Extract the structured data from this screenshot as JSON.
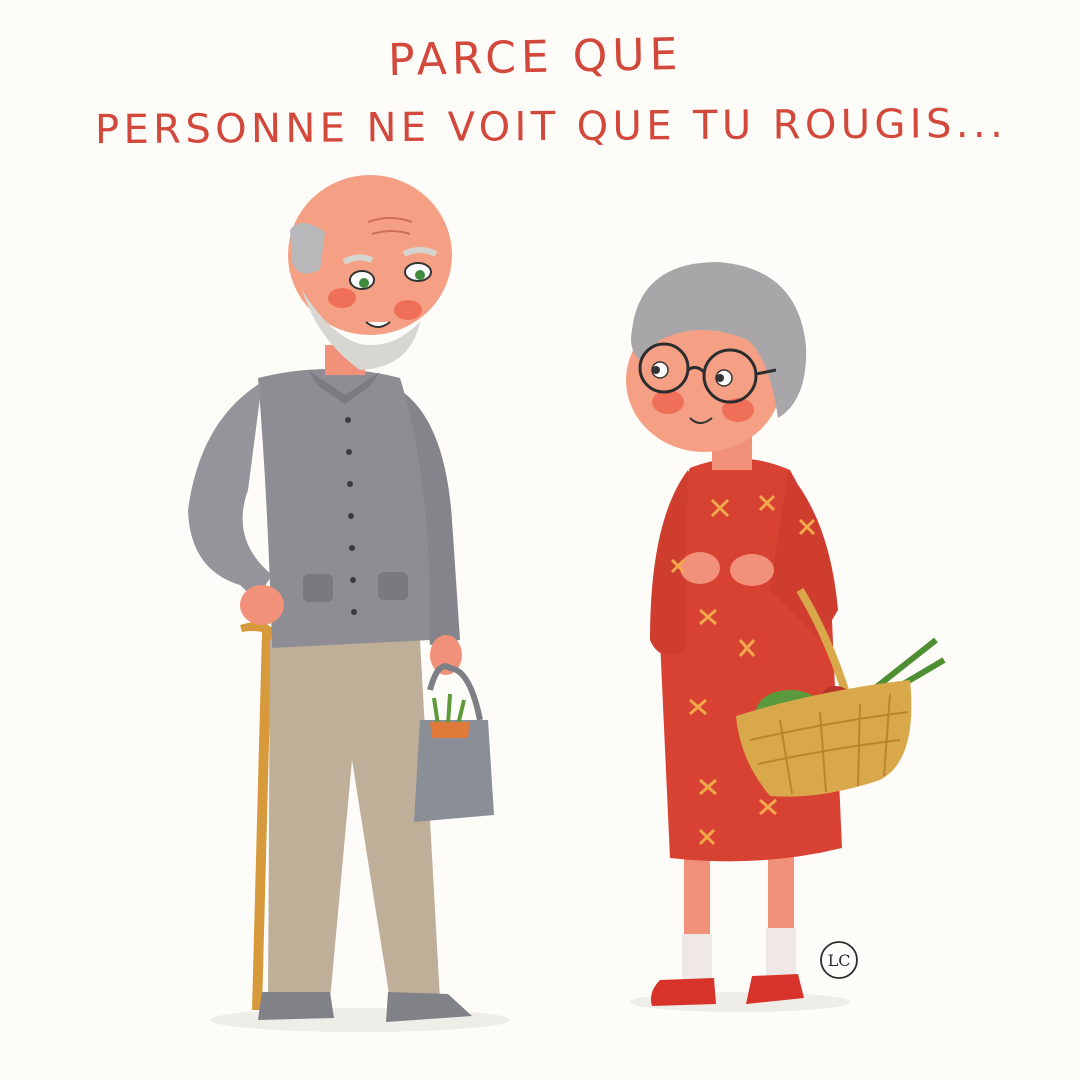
{
  "caption": {
    "line1": "PARCE QUE",
    "line2": "PERSONNE NE VOIT QUE TU ROUGIS..."
  },
  "signature": "LC",
  "colors": {
    "caption_red": "#d2483a",
    "background": "#fdfcf9",
    "cardigan_gray": "#8e8d93",
    "trousers_beige": "#bfae98",
    "dress_red": "#d84232",
    "skin": "#f2917a",
    "hair_gray": "#a8a6a8",
    "basket_ochre": "#d9a84a"
  },
  "scene": {
    "figures": [
      "man-with-cane",
      "woman-with-basket"
    ]
  }
}
